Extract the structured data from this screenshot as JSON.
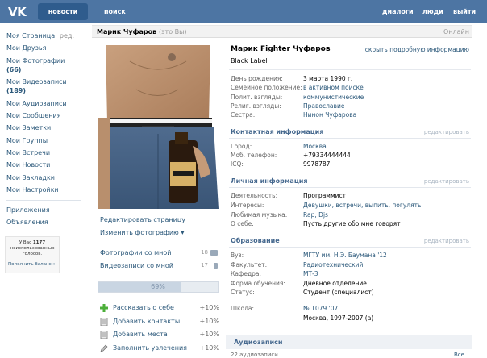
{
  "topbar": {
    "logo": "VK",
    "tab_news": "новости",
    "search": "поиск",
    "dialogs": "диалоги",
    "people": "люди",
    "logout": "выйти"
  },
  "nav": {
    "my_page": "Моя Страница",
    "edit": "ред.",
    "friends": "Мои Друзья",
    "photos": "Мои Фотографии",
    "photos_count": "(66)",
    "videos": "Мои Видеозаписи",
    "videos_count": "(189)",
    "audio": "Мои Аудиозаписи",
    "messages": "Мои Сообщения",
    "notes": "Мои Заметки",
    "groups": "Мои Группы",
    "meetings": "Мои Встречи",
    "news": "Мои Новости",
    "bookmarks": "Мои Закладки",
    "settings": "Мои Настройки",
    "apps": "Приложения",
    "ads": "Объявления"
  },
  "balance": {
    "line1a": "У Вас ",
    "amount": "1177",
    "line2": "неиспользованных",
    "line3": "голосов.",
    "link": "Пополнить баланс »"
  },
  "header": {
    "name": "Марик Чуфаров",
    "sub": "(это Вы)",
    "online": "Онлайн"
  },
  "photo_actions": {
    "edit_page": "Редактировать страницу",
    "change_photo": "Изменить фотографию ▾",
    "photos_with_me": "Фотографии со мной",
    "photos_with_me_count": "18",
    "videos_with_me": "Видеозаписи со мной",
    "videos_with_me_count": "17"
  },
  "progress": {
    "label": "69%",
    "value": 69
  },
  "actions": [
    {
      "label": "Рассказать о себе",
      "plus": "+10%"
    },
    {
      "label": "Добавить контакты",
      "plus": "+10%"
    },
    {
      "label": "Добавить места",
      "plus": "+10%"
    },
    {
      "label": "Заполнить увлечения",
      "plus": "+10%"
    }
  ],
  "info": {
    "name": "Марик Fighter Чуфаров",
    "status": "Black Label",
    "detailed": "скрыть подробную информацию",
    "basic": [
      {
        "label": "День рождения:",
        "value": "3 марта 1990 г.",
        "link": false
      },
      {
        "label": "Семейное положение:",
        "value": "в активном поиске",
        "link": true
      },
      {
        "label": "Полит. взгляды:",
        "value": "коммунистические",
        "link": true
      },
      {
        "label": "Религ. взгляды:",
        "value": "Православие",
        "link": true
      },
      {
        "label": "Сестра:",
        "value": "Нинон Чуфарова",
        "link": true
      }
    ],
    "contact_title": "Контактная информация",
    "contact_edit": "редактировать",
    "contact": [
      {
        "label": "Город:",
        "value": "Москва",
        "link": true
      },
      {
        "label": "Моб. телефон:",
        "value": "+79334444444",
        "link": false
      },
      {
        "label": "ICQ:",
        "value": "9978787",
        "link": false
      }
    ],
    "personal_title": "Личная информация",
    "personal_edit": "редактировать",
    "personal": [
      {
        "label": "Деятельность:",
        "value": "Программист",
        "link": false
      },
      {
        "label": "Интересы:",
        "value": "Девушки, встречи, выпить, погулять",
        "link": true
      },
      {
        "label": "Любимая музыка:",
        "value": "Rap, Djs",
        "link": true
      },
      {
        "label": "О себе:",
        "value": "Пусть другие обо мне говорят",
        "link": false
      }
    ],
    "edu_title": "Образование",
    "edu_edit": "редактировать",
    "edu": [
      {
        "label": "Вуз:",
        "value": "МГТУ им. Н.Э. Баумана '12",
        "link": true
      },
      {
        "label": "Факультет:",
        "value": "Радиотехнический",
        "link": true
      },
      {
        "label": "Кафедра:",
        "value": "МТ-3",
        "link": true
      },
      {
        "label": "Форма обучения:",
        "value": "Дневное отделение",
        "link": false
      },
      {
        "label": "Статус:",
        "value": "Студент (специалист)",
        "link": false
      }
    ],
    "school_label": "Школа:",
    "school_value": "№ 1079 '07",
    "school_value2": "Москва, 1997-2007 (а)"
  },
  "audio": {
    "title": "Аудиозаписи",
    "sub": "22 аудиозаписи",
    "all": "Все"
  }
}
